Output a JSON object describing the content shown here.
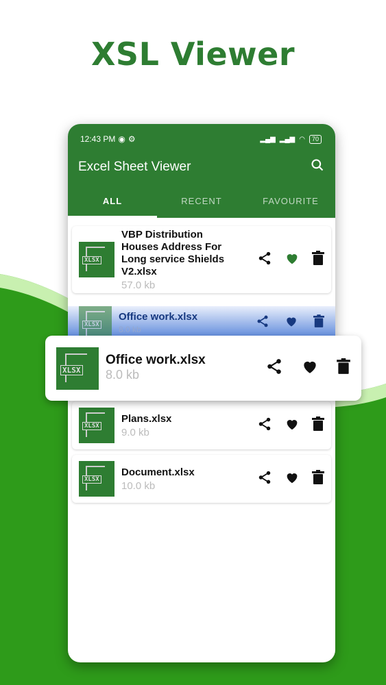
{
  "headline": "XSL Viewer",
  "status_bar": {
    "time": "12:43 PM",
    "battery": "70"
  },
  "app": {
    "title": "Excel Sheet Viewer"
  },
  "tabs": [
    {
      "label": "ALL",
      "active": true
    },
    {
      "label": "RECENT",
      "active": false
    },
    {
      "label": "FAVOURITE",
      "active": false
    }
  ],
  "files": [
    {
      "name": "VBP Distribution Houses Address For Long service Shields V2.xlsx",
      "size": "57.0 kb",
      "favourite": true,
      "icon_label": "XLSX"
    },
    {
      "name": "Office work.xlsx",
      "size": "8.0 kb",
      "favourite": true,
      "icon_label": "XLSX"
    },
    {
      "name": "Plans.xlsx",
      "size": "9.0 kb",
      "favourite": true,
      "icon_label": "XLSX"
    },
    {
      "name": "Document.xlsx",
      "size": "10.0 kb",
      "favourite": true,
      "icon_label": "XLSX"
    }
  ],
  "highlight": {
    "name": "Office work.xlsx",
    "size": "8.0 kb",
    "icon_label": "XLSX"
  },
  "colors": {
    "brand": "#2e7d32",
    "accent_blue": "#4f7fd8"
  }
}
